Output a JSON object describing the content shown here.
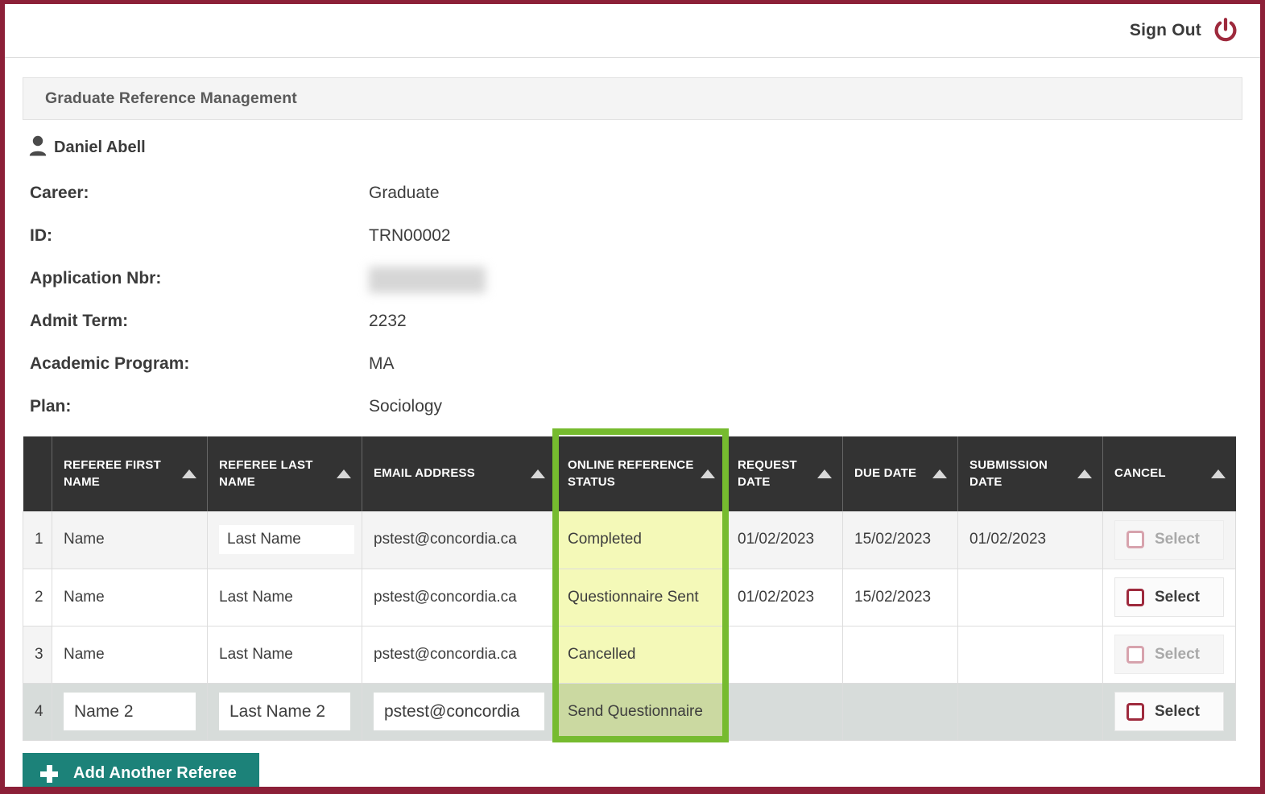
{
  "topbar": {
    "sign_out_label": "Sign Out",
    "power_icon": "power-icon",
    "accent_color": "#8c2038"
  },
  "panel": {
    "title": "Graduate Reference Management"
  },
  "student": {
    "avatar_icon": "user-icon",
    "name": "Daniel Abell",
    "fields": [
      {
        "label": "Career:",
        "value": "Graduate",
        "redacted": false
      },
      {
        "label": "ID:",
        "value": "TRN00002",
        "redacted": false
      },
      {
        "label": "Application Nbr:",
        "value": "",
        "redacted": true
      },
      {
        "label": "Admit Term:",
        "value": "2232",
        "redacted": false
      },
      {
        "label": "Academic Program:",
        "value": "MA",
        "redacted": false
      },
      {
        "label": "Plan:",
        "value": "Sociology",
        "redacted": false
      }
    ]
  },
  "table": {
    "columns": [
      {
        "label": "REFEREE FIRST NAME",
        "sortable": true
      },
      {
        "label": "REFEREE LAST NAME",
        "sortable": true
      },
      {
        "label": "EMAIL ADDRESS",
        "sortable": true
      },
      {
        "label": "ONLINE REFERENCE STATUS",
        "sortable": true
      },
      {
        "label": "REQUEST DATE",
        "sortable": true
      },
      {
        "label": "DUE DATE",
        "sortable": true
      },
      {
        "label": "SUBMISSION DATE",
        "sortable": true
      },
      {
        "label": "CANCEL",
        "sortable": true
      }
    ],
    "rows": [
      {
        "num": "1",
        "first_name": "Name",
        "last_name": "Last Name",
        "email": "pstest@concordia.ca",
        "status": "Completed",
        "request_date": "01/02/2023",
        "due_date": "15/02/2023",
        "submission_date": "01/02/2023",
        "select_label": "Select",
        "select_enabled": false
      },
      {
        "num": "2",
        "first_name": "Name",
        "last_name": "Last Name",
        "email": "pstest@concordia.ca",
        "status": "Questionnaire Sent",
        "request_date": "01/02/2023",
        "due_date": "15/02/2023",
        "submission_date": "",
        "select_label": "Select",
        "select_enabled": true
      },
      {
        "num": "3",
        "first_name": "Name",
        "last_name": "Last Name",
        "email": "pstest@concordia.ca",
        "status": "Cancelled",
        "request_date": "",
        "due_date": "",
        "submission_date": "",
        "select_label": "Select",
        "select_enabled": false
      },
      {
        "num": "4",
        "first_name": "Name 2",
        "last_name": "Last Name 2",
        "email": "pstest@concordia",
        "status": "Send Questionnaire",
        "request_date": "",
        "due_date": "",
        "submission_date": "",
        "select_label": "Select",
        "select_enabled": true
      }
    ],
    "highlight_color": "#76bb2f",
    "status_highlight_color": "#f4f9b8"
  },
  "actions": {
    "add_referee_label": "Add Another Referee",
    "add_icon": "plus-icon",
    "add_color": "#1c8279"
  }
}
